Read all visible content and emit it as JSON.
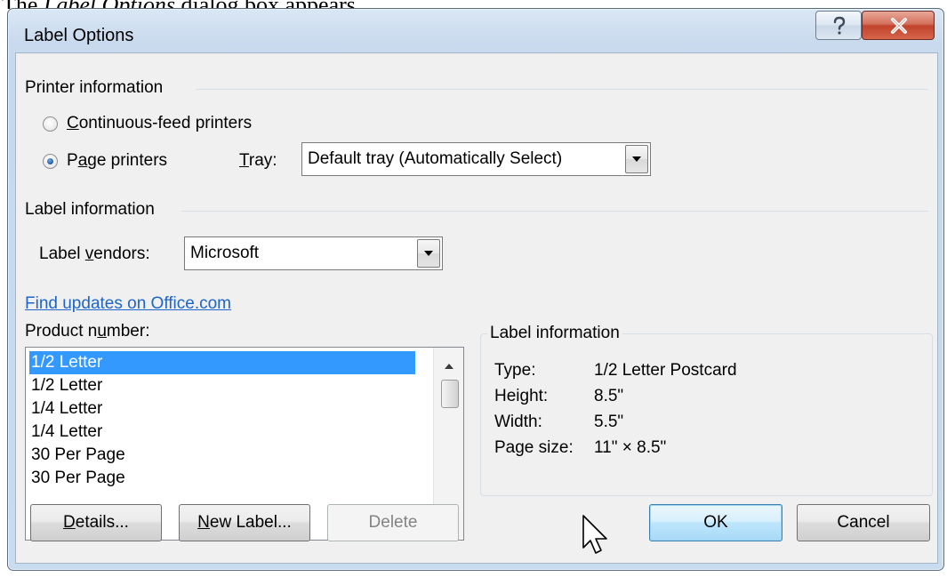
{
  "caption": {
    "prefix": "The ",
    "emphasis": "Label Options",
    "suffix": " dialog box appears."
  },
  "window": {
    "title": "Label Options"
  },
  "titlebar": {
    "help_icon": "question-mark-icon",
    "close_icon": "close-x-icon"
  },
  "printer_info": {
    "group_title": "Printer information",
    "continuous": {
      "pre": "",
      "accel": "C",
      "post": "ontinuous-feed printers",
      "selected": false
    },
    "page": {
      "pre": "P",
      "accel": "a",
      "post": "ge printers",
      "selected": true
    },
    "tray": {
      "accel": "T",
      "post": "ray:",
      "value": "Default tray (Automatically Select)"
    }
  },
  "label_info": {
    "group_title": "Label information",
    "vendors": {
      "pre": "Label ",
      "accel": "v",
      "post": "endors:",
      "value": "Microsoft"
    },
    "link": "Find updates on Office.com"
  },
  "product": {
    "pre": "Product n",
    "accel": "u",
    "post": "mber:",
    "items": [
      "1/2 Letter",
      "1/2 Letter",
      "1/4 Letter",
      "1/4 Letter",
      "30 Per Page",
      "30 Per Page"
    ],
    "selected_index": 0
  },
  "details_panel": {
    "title": "Label information",
    "rows": [
      {
        "key": "Type:",
        "value": "1/2 Letter Postcard"
      },
      {
        "key": "Height:",
        "value": "8.5\""
      },
      {
        "key": "Width:",
        "value": "5.5\""
      },
      {
        "key": "Page size:",
        "value": "11\" × 8.5\""
      }
    ]
  },
  "buttons": {
    "details": {
      "accel": "D",
      "post": "etails..."
    },
    "new_label": {
      "accel": "N",
      "post": "ew Label..."
    },
    "delete": "Delete",
    "ok": "OK",
    "cancel": "Cancel"
  },
  "cursor_icon": "mouse-pointer-icon"
}
